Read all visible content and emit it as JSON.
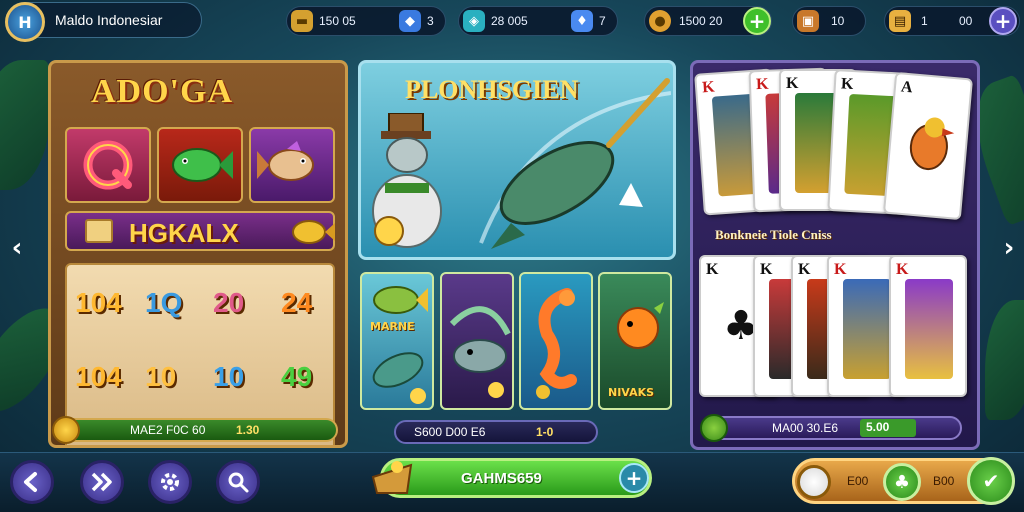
{
  "header": {
    "logo_badge": "H",
    "app_title": "Maldo Indonesiar",
    "resources": [
      {
        "icon": "gold-bar-icon",
        "value": "150 05"
      },
      {
        "icon": "gem-icon",
        "value": "3"
      },
      {
        "icon": "crystal-icon",
        "value": "28 005"
      },
      {
        "icon": "diamond-icon",
        "value": "7"
      },
      {
        "icon": "coin-stack-icon",
        "value": "1500 20"
      },
      {
        "icon": "treasure-chest-icon",
        "value": "10"
      },
      {
        "icon": "card-box-icon",
        "value": "1"
      },
      {
        "icon": "",
        "value": "00"
      }
    ]
  },
  "left_game": {
    "title": "ADO'GA",
    "banner": "HGKALX",
    "numbers": [
      "104",
      "1Q",
      "20",
      "24",
      "104",
      "10",
      "10",
      "49"
    ],
    "footer_label": "MAE2 F0C 60",
    "footer_value": "1.30"
  },
  "middle_game": {
    "title": "PLONHSGIEN",
    "mini_labels": [
      "MARNE",
      "NIVAKS"
    ],
    "footer_label": "S600 D00 E6",
    "footer_value": "1-0"
  },
  "right_game": {
    "caption": "Bonkneie Tiole Cniss",
    "top_cards": [
      "K",
      "K",
      "K",
      "K",
      "A"
    ],
    "bottom_cards": [
      "K",
      "K",
      "K",
      "K",
      "K"
    ],
    "footer_label": "MA00 30.E6",
    "footer_value": "5.00"
  },
  "nav": {
    "prev": "‹",
    "next": "›"
  },
  "bottom": {
    "main_button": "GAHMS659",
    "coin_a": "E00",
    "coin_b": "B00"
  },
  "colors": {
    "accent_green": "#3fbf2a",
    "accent_purple": "#5a4fc0",
    "gold": "#ffd54a"
  }
}
